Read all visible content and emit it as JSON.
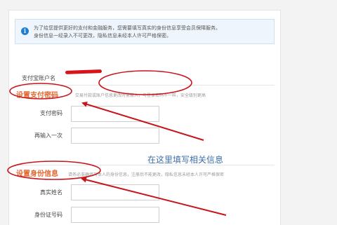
{
  "notice": {
    "icon": "info-icon",
    "line1": "为了给您提供更好的支付和金融服务，您需要填写真实的身份信息享受会员保障服务。",
    "line2": "身份信息一经录入不可更改，隐私信息未经本人许可严格保密。"
  },
  "account": {
    "label": "支付宝账户名"
  },
  "pay_password": {
    "title": "设置支付密码",
    "hint": "交易付款或账户信息更改时需输入，与登录密码不一样，安全级别更高",
    "field1_label": "支付密码",
    "field2_label": "再输入一次"
  },
  "identity": {
    "title": "设置身份信息",
    "hint": "请务必准确填写本人的身份信息，注册后不能更改，隐私信息未经本人许可严格保密",
    "name_label": "真实姓名",
    "id_label": "身份证号码"
  },
  "annotation": {
    "text": "在这里填写相关信息",
    "color": "#c8141b"
  },
  "colors": {
    "accent": "#e0662f",
    "annotation_red": "#c8141b"
  }
}
